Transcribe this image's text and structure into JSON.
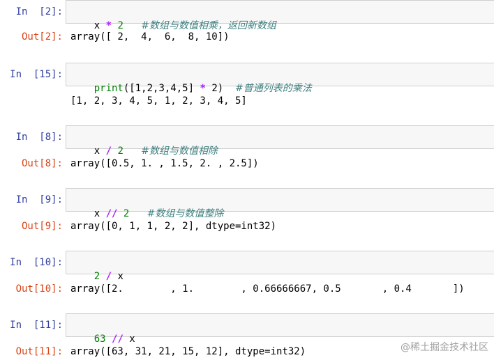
{
  "cells": [
    {
      "in_prompt": "In  [2]:",
      "code": {
        "a": "x ",
        "op": "*",
        "num": " 2",
        "comment": "#数组与数值相乘，返回新数组"
      },
      "out_prompt": "Out[2]:",
      "output": "array([ 2,  4,  6,  8, 10])"
    },
    {
      "in_prompt": "In  [15]:",
      "code": {
        "fn": "print",
        "a": "([1,2,3,4,5] ",
        "op": "*",
        "num": " 2)",
        "comment": "#普通列表的乘法"
      },
      "out_prompt": "",
      "output": "[1, 2, 3, 4, 5, 1, 2, 3, 4, 5]"
    },
    {
      "in_prompt": "In  [8]:",
      "code": {
        "a": "x ",
        "op": "/",
        "num": " 2",
        "comment": "#数组与数值相除"
      },
      "out_prompt": "Out[8]:",
      "output": "array([0.5, 1. , 1.5, 2. , 2.5])"
    },
    {
      "in_prompt": "In  [9]:",
      "code": {
        "a": "x ",
        "op": "//",
        "num": " 2",
        "comment": "#数组与数值整除"
      },
      "out_prompt": "Out[9]:",
      "output": "array([0, 1, 1, 2, 2], dtype=int32)"
    },
    {
      "in_prompt": "In  [10]:",
      "code": {
        "a": "2 ",
        "op": "/",
        "num": " x",
        "comment": ""
      },
      "out_prompt": "Out[10]:",
      "output": "array([2.        , 1.        , 0.66666667, 0.5       , 0.4       ])"
    },
    {
      "in_prompt": "In  [11]:",
      "code": {
        "a": "63 ",
        "op": "//",
        "num": " x",
        "comment": ""
      },
      "out_prompt": "Out[11]:",
      "output": "array([63, 31, 21, 15, 12], dtype=int32)"
    }
  ],
  "watermark": "@稀土掘金技术社区"
}
